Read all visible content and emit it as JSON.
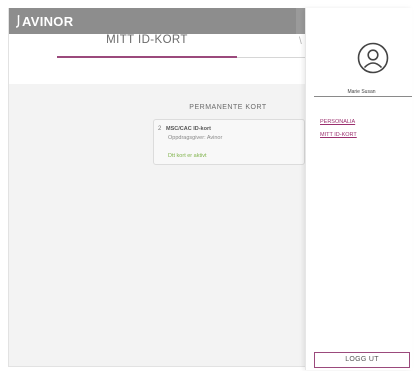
{
  "header": {
    "brand": "AVINOR"
  },
  "tabs": {
    "active_label": "MITT ID-KORT",
    "peek_label": "\\"
  },
  "main": {
    "section_title": "PERMANENTE KORT",
    "card": {
      "icon_glyph": "2",
      "title": "MSC/CAC ID-kort",
      "subtitle": "Oppdragsgiver: Avinor",
      "status": "Dtt kort er aktivt",
      "status_color": "#7fb34a"
    }
  },
  "drawer": {
    "user_name": "Marie Susan",
    "menu": [
      {
        "label": "PERSONALIA"
      },
      {
        "label": "MITT ID-KORT"
      }
    ],
    "logout_label": "LOGG UT",
    "accent_color": "#9b2f6e"
  },
  "icons": {
    "brand": "avinor-logo-mark-icon",
    "avatar": "user-avatar-icon"
  }
}
